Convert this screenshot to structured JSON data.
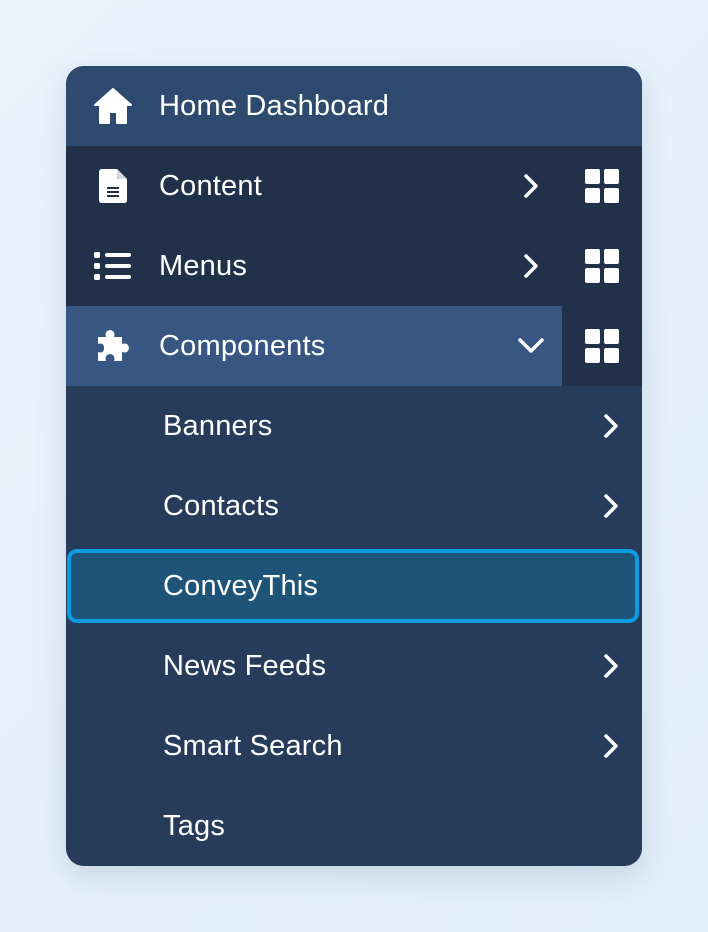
{
  "menu": {
    "top_items": [
      {
        "label": "Home Dashboard",
        "icon": "home-icon",
        "has_chevron": false,
        "has_grid": false
      },
      {
        "label": "Content",
        "icon": "file-icon",
        "chevron": "chevron-right-icon",
        "has_grid": true
      },
      {
        "label": "Menus",
        "icon": "list-icon",
        "chevron": "chevron-right-icon",
        "has_grid": true
      },
      {
        "label": "Components",
        "icon": "puzzle-icon",
        "chevron": "chevron-down-icon",
        "has_grid": true,
        "expanded": true
      }
    ],
    "sub_items": [
      {
        "label": "Banners",
        "has_chevron": true
      },
      {
        "label": "Contacts",
        "has_chevron": true
      },
      {
        "label": "ConveyThis",
        "has_chevron": false,
        "selected": true
      },
      {
        "label": "News Feeds",
        "has_chevron": true
      },
      {
        "label": "Smart Search",
        "has_chevron": true
      },
      {
        "label": "Tags",
        "has_chevron": false
      }
    ]
  },
  "colors": {
    "page_background": "#e6f0fb",
    "home_row": "#2e4a6e",
    "dark_row": "#213149",
    "active_row": "#375782",
    "submenu_bg": "#273b5a",
    "selected_fill": "#1f5479",
    "selected_border": "#0b9be0",
    "text": "#ffffff"
  }
}
